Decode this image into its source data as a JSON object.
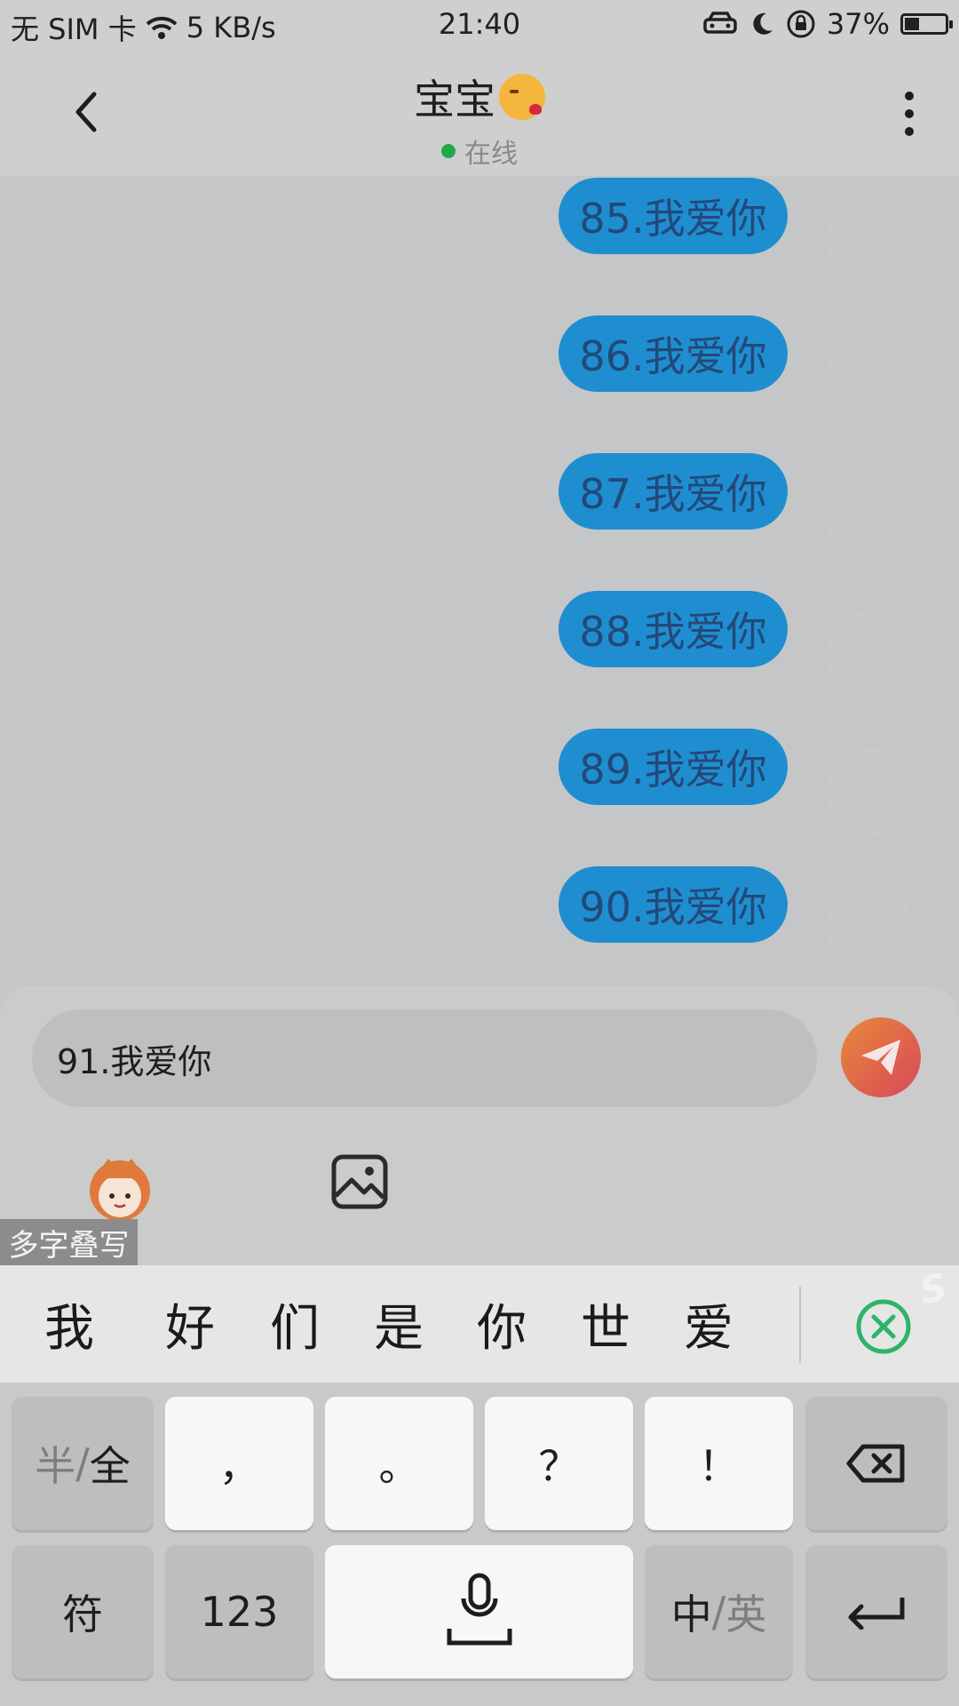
{
  "status_bar": {
    "carrier": "无 SIM 卡",
    "speed": "5 KB/s",
    "time": "21:40",
    "battery": "37%",
    "battery_level": 0.37
  },
  "header": {
    "title": "宝宝",
    "title_emoji": "kissing-face-emoji",
    "status": "在线"
  },
  "messages": [
    {
      "text": "85.我爱你"
    },
    {
      "text": "86.我爱你"
    },
    {
      "text": "87.我爱你"
    },
    {
      "text": "88.我爱你"
    },
    {
      "text": "89.我爱你"
    },
    {
      "text": "90.我爱你"
    }
  ],
  "composer": {
    "value": "91.我爱你",
    "handwriting_label": "多字叠写"
  },
  "candidates": [
    "我",
    "好",
    "们",
    "是",
    "你",
    "世",
    "爱"
  ],
  "keyboard": {
    "row1": {
      "half": "半",
      "slash": "/",
      "full": "全",
      "comma": "，",
      "period": "。",
      "question": "？",
      "exclaim": "！"
    },
    "row2": {
      "symbols": "符",
      "numbers": "123",
      "zh": "中",
      "slash": "/",
      "en": "英"
    }
  },
  "colors": {
    "bubble": "#1f8ed0",
    "online": "#21a84a",
    "send_gradient_start": "#e8893a",
    "send_gradient_end": "#d8475a",
    "candidate_close": "#2fb36a"
  }
}
